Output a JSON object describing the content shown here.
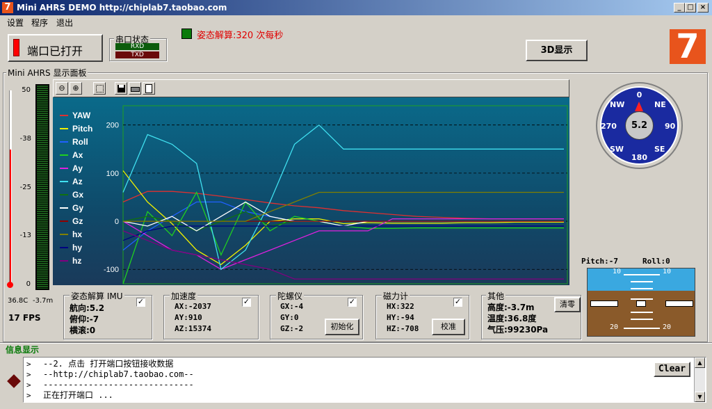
{
  "window": {
    "title": "Mini AHRS DEMO http://chiplab7.taobao.com",
    "logo": "7",
    "min": "_",
    "max": "□",
    "close": "×"
  },
  "menu": [
    "设置",
    "程序",
    "退出"
  ],
  "port_button": {
    "label": "端口已打开"
  },
  "serial_status": {
    "title": "串口状态",
    "rxd": "RXD",
    "txd": "TXD"
  },
  "solve_rate": {
    "text": "姿态解算:320 次每秒"
  },
  "btn_3d": "3D显示",
  "brand_logo": "7",
  "panel_title": "Mini AHRS 显示面板",
  "gauge": {
    "ticks": [
      "50",
      "-38",
      "-25",
      "-13",
      "0"
    ],
    "temp": "36.8C",
    "alt": "-3.7m",
    "fps": "17 FPS"
  },
  "toolbar_icons": [
    "zoom-out-icon",
    "zoom-in-icon",
    "select-icon",
    "save-icon",
    "print-icon",
    "print-preview-icon"
  ],
  "chart_data": {
    "type": "line",
    "ylim": [
      -130,
      240
    ],
    "yticks": [
      "200",
      "100",
      "0",
      "-100"
    ],
    "series": [
      {
        "name": "YAW",
        "color": "#e03030",
        "values": [
          40,
          62,
          62,
          58,
          52,
          45,
          38,
          32,
          28,
          22,
          18,
          14,
          10,
          8,
          6,
          5,
          5,
          5,
          5
        ]
      },
      {
        "name": "Pitch",
        "color": "#f0f000",
        "values": [
          105,
          40,
          -5,
          -60,
          -90,
          -50,
          0,
          5,
          5,
          -5,
          -3,
          -4,
          -4,
          -4,
          -3,
          -3,
          -2,
          -2,
          -2
        ]
      },
      {
        "name": "Roll",
        "color": "#2060ff",
        "values": [
          -60,
          -20,
          10,
          40,
          40,
          20,
          10,
          0,
          0,
          0,
          0,
          0,
          0,
          0,
          0,
          0,
          0,
          0,
          0
        ]
      },
      {
        "name": "Ax",
        "color": "#20d020",
        "values": [
          -130,
          20,
          -30,
          60,
          -70,
          40,
          -20,
          10,
          0,
          -10,
          -15,
          -15,
          -14,
          -14,
          -14,
          -14,
          -14,
          -14,
          -14
        ]
      },
      {
        "name": "Ay",
        "color": "#e020e0",
        "values": [
          0,
          -30,
          -60,
          -70,
          -100,
          -80,
          -60,
          -40,
          -20,
          -20,
          -20,
          5,
          5,
          5,
          5,
          5,
          5,
          5,
          5
        ]
      },
      {
        "name": "Az",
        "color": "#40e0f0",
        "values": [
          60,
          180,
          160,
          120,
          -100,
          -60,
          40,
          160,
          200,
          150,
          150,
          150,
          150,
          150,
          150,
          150,
          150,
          150,
          150
        ]
      },
      {
        "name": "Gx",
        "color": "#107010",
        "values": [
          0,
          10,
          0,
          -20,
          0,
          20,
          -10,
          0,
          0,
          0,
          0,
          0,
          0,
          0,
          0,
          0,
          0,
          0,
          0
        ]
      },
      {
        "name": "Gy",
        "color": "#ffffff",
        "values": [
          0,
          -10,
          10,
          -20,
          10,
          40,
          10,
          0,
          0,
          -10,
          0,
          0,
          0,
          0,
          0,
          0,
          0,
          0,
          0
        ]
      },
      {
        "name": "Gz",
        "color": "#900000",
        "values": [
          0,
          0,
          0,
          0,
          0,
          0,
          0,
          0,
          0,
          0,
          0,
          0,
          0,
          0,
          0,
          0,
          0,
          0,
          0
        ]
      },
      {
        "name": "hx",
        "color": "#808000",
        "values": [
          0,
          0,
          0,
          0,
          0,
          0,
          20,
          40,
          60,
          60,
          60,
          60,
          60,
          60,
          60,
          60,
          60,
          60,
          60
        ]
      },
      {
        "name": "hy",
        "color": "#000080",
        "values": [
          -40,
          -20,
          -10,
          -10,
          -10,
          -10,
          -10,
          -10,
          -10,
          -10,
          -10,
          -10,
          -10,
          -10,
          -10,
          -10,
          -10,
          -10,
          -10
        ]
      },
      {
        "name": "hz",
        "color": "#800080",
        "values": [
          -20,
          -40,
          -60,
          -70,
          -80,
          -90,
          -100,
          -120,
          -120,
          -120,
          -120,
          -120,
          -120,
          -120,
          -120,
          -120,
          -120,
          -120,
          -120
        ]
      }
    ]
  },
  "compass": {
    "value": "5.2",
    "N": "0",
    "NE": "NE",
    "E": "90",
    "SE": "SE",
    "S": "180",
    "SW": "SW",
    "W": "270",
    "NW": "NW"
  },
  "attitude": {
    "pitch_label": "Pitch:-7",
    "roll_label": "Roll:0",
    "ticks": [
      "10",
      "10",
      "20",
      "20"
    ]
  },
  "imu": {
    "title": "姿态解算 IMU",
    "heading": "航向:5.2",
    "pitch": "俯仰:-7",
    "roll": "横滚:0",
    "checked": "✓"
  },
  "accel": {
    "title": "加速度",
    "ax": "AX:-2037",
    "ay": "AY:910",
    "az": "AZ:15374",
    "checked": "✓"
  },
  "gyro": {
    "title": "陀螺仪",
    "gx": "GX:-4",
    "gy": "GY:0",
    "gz": "GZ:-2",
    "init": "初始化",
    "checked": "✓"
  },
  "mag": {
    "title": "磁力计",
    "hx": "HX:322",
    "hy": "HY:-94",
    "hz": "HZ:-708",
    "calib": "校准",
    "checked": "✓"
  },
  "other": {
    "title": "其他",
    "height": "高度:-3.7m",
    "temp": "温度:36.8度",
    "pressure": "气压:99230Pa",
    "clear": "清零"
  },
  "info": {
    "title": "信息显示",
    "lines": [
      "--2. 点击 打开端口按钮接收数据",
      "--http://chiplab7.taobao.com--",
      "------------------------------",
      "正在打开端口 ..."
    ],
    "prompt": ">",
    "clear": "Clear"
  }
}
